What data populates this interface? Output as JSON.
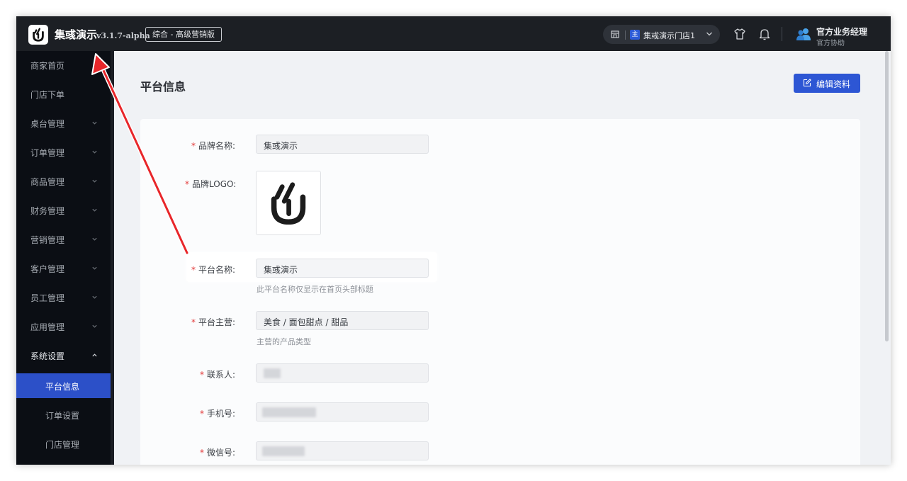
{
  "topbar": {
    "brand": "集彧演示",
    "version": "v3.1.7-alpha",
    "edition": "综合 - 高级营销版",
    "store_badge": "主",
    "store_name": "集彧演示门店1",
    "user_name": "官方业务经理",
    "user_role": "官方协助"
  },
  "sidebar": {
    "items": [
      {
        "label": "商家首页",
        "has_children": false
      },
      {
        "label": "门店下单",
        "has_children": false
      },
      {
        "label": "桌台管理",
        "has_children": true
      },
      {
        "label": "订单管理",
        "has_children": true
      },
      {
        "label": "商品管理",
        "has_children": true
      },
      {
        "label": "财务管理",
        "has_children": true
      },
      {
        "label": "营销管理",
        "has_children": true
      },
      {
        "label": "客户管理",
        "has_children": true
      },
      {
        "label": "员工管理",
        "has_children": true
      },
      {
        "label": "应用管理",
        "has_children": true
      },
      {
        "label": "系统设置",
        "has_children": true,
        "expanded": true
      }
    ],
    "sub_items": [
      {
        "label": "平台信息",
        "active": true
      },
      {
        "label": "订单设置",
        "active": false
      },
      {
        "label": "门店管理",
        "active": false
      }
    ]
  },
  "main": {
    "title": "平台信息",
    "edit_button": "编辑资料",
    "required_mark": "*",
    "fields": {
      "brand_name": {
        "label": "品牌名称:",
        "value": "集彧演示"
      },
      "brand_logo": {
        "label": "品牌LOGO:"
      },
      "platform_name": {
        "label": "平台名称:",
        "value": "集彧演示",
        "hint": "此平台名称仅显示在首页头部标题"
      },
      "platform_main": {
        "label": "平台主营:",
        "value": "美食 / 面包甜点 / 甜品",
        "hint": "主营的产品类型"
      },
      "contact": {
        "label": "联系人:"
      },
      "phone": {
        "label": "手机号:"
      },
      "wechat": {
        "label": "微信号:"
      }
    }
  },
  "colors": {
    "topbar": "#1c1f24",
    "sidebar": "#0b0e14",
    "accent": "#2d56d4",
    "required": "#e33b3b",
    "arrow": "#e8262a"
  }
}
